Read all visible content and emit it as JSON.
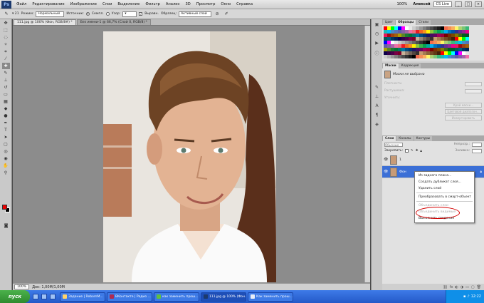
{
  "menubar": {
    "logo": "Ps",
    "items": [
      "Файл",
      "Редактирование",
      "Изображение",
      "Слои",
      "Выделение",
      "Фильтр",
      "Анализ",
      "3D",
      "Просмотр",
      "Окно",
      "Справка"
    ],
    "zoom": "100%",
    "workspace": "Алексей",
    "cslive": "CS Live"
  },
  "options": {
    "mode_label": "Режим:",
    "mode_value": "Нормальный",
    "source_label": "Источник:",
    "source_sampled": "Семпл.",
    "source_pattern": "Узор:",
    "aligned_label": "Выравн.",
    "sample_label": "Образец:",
    "sample_value": "Активный слой"
  },
  "document": {
    "tabs": [
      "111.jpg @ 100% (Фон, RGB/8#) *",
      "Без имени-1 @ 66,7% (Слой 0, RGB/8) *"
    ],
    "zoom": "100%",
    "doc_info": "Док: 1,00M/1,00M"
  },
  "panels": {
    "top_tabs": [
      "Цвет",
      "Образцы",
      "Стили"
    ],
    "mask_tabs": [
      "Маски",
      "Коррекция"
    ],
    "mask_label": "Маски не выбрана",
    "mask_fields": [
      "Плотность:",
      "Растушевка:",
      "Уточнить:"
    ],
    "mask_buttons": [
      "Край маски...",
      "Цветовой диапазон...",
      "Инвертировать"
    ],
    "layer_tabs": [
      "Слои",
      "Каналы",
      "Контуры"
    ],
    "layer_mode": "Обычные",
    "layer_opacity_label": "Непрозр.:",
    "lock_label": "Закрепить:",
    "fill_label": "Заливка:",
    "layers": [
      {
        "name": "1",
        "selected": false
      },
      {
        "name": "Фон",
        "selected": true
      }
    ]
  },
  "context_menu": {
    "items": [
      {
        "label": "Из заднего плана...",
        "disabled": false
      },
      {
        "label": "Создать дубликат слоя...",
        "disabled": false
      },
      {
        "label": "Удалить слой",
        "disabled": false
      },
      {
        "sep": true
      },
      {
        "label": "Преобразовать в смарт-объект",
        "disabled": false
      },
      {
        "sep": true
      },
      {
        "label": "Объединить слои",
        "disabled": true
      },
      {
        "label": "Объединить видимые",
        "disabled": true
      },
      {
        "label": "Выполнить сведение",
        "disabled": false
      }
    ]
  },
  "taskbar": {
    "start": "пуск",
    "buttons": [
      {
        "label": "Задание | RebornM...",
        "color": "#ffd36a"
      },
      {
        "label": "ВКонтакте | Радио ...",
        "color": "#b02a50"
      },
      {
        "label": "как заменить прош...",
        "color": "#5fbf3f"
      },
      {
        "label": "111.jpg @ 100% (Фон...",
        "color": "#1c3a6e"
      },
      {
        "label": "Как заменить прош...",
        "color": "#e8eef7"
      }
    ],
    "time": "12:22"
  },
  "colors": {
    "foreground": "#e00000",
    "background": "#000000",
    "selection": "#3b6fd6",
    "highlight_circle": "#d40000"
  }
}
